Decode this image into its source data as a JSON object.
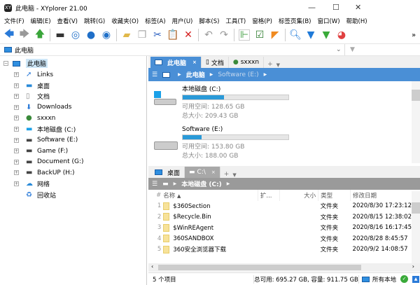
{
  "window": {
    "title": "此电脑 - XYplorer 21.00",
    "logo": "XY"
  },
  "menu": [
    "文件(F)",
    "编辑(E)",
    "查看(V)",
    "跳转(G)",
    "收藏夹(O)",
    "标签(A)",
    "用户(U)",
    "脚本(S)",
    "工具(T)",
    "窗格(P)",
    "标签页集(B)",
    "窗口(W)",
    "帮助(H)"
  ],
  "toolbar": {
    "icons": [
      "back-arrow-icon",
      "forward-arrow-icon",
      "up-arrow-icon",
      "computer-icon",
      "target-icon",
      "search-circle-icon",
      "goto-icon",
      "new-folder-icon",
      "copy-icon",
      "cut-icon",
      "paste-icon",
      "delete-icon",
      "undo-icon",
      "redo-icon",
      "tree-icon",
      "checkbox-icon",
      "pizza-icon",
      "search-icon",
      "filter-icon",
      "green-filter-icon",
      "pie-chart-icon"
    ],
    "more": "»"
  },
  "address": {
    "value": "此电脑"
  },
  "tree": {
    "root": "此电脑",
    "items": [
      "Links",
      "桌面",
      "文档",
      "Downloads",
      "sxxxn",
      "本地磁盘 (C:)",
      "Software (E:)",
      "Game (F:)",
      "Document (G:)",
      "BackUP (H:)",
      "网络",
      "回收站"
    ]
  },
  "pane1": {
    "tabs": [
      "此电脑",
      "文档",
      "sxxxn"
    ],
    "crumbs": [
      "此电脑",
      "Software (E:)"
    ],
    "drives": [
      {
        "name": "本地磁盘 (C:)",
        "used_fraction": 0.39,
        "free": "可用空间: 128.65 GB",
        "total": "总大小: 209.43 GB"
      },
      {
        "name": "Software (E:)",
        "used_fraction": 0.18,
        "free": "可用空间: 153.80 GB",
        "total": "总大小: 188.00 GB"
      }
    ]
  },
  "pane2": {
    "tabs": [
      "桌面",
      "C:\\"
    ],
    "crumbs": [
      "本地磁盘 (C:)"
    ],
    "columns": [
      "#",
      "名称",
      "扩...",
      "大小",
      "类型",
      "修改日期"
    ],
    "rows": [
      [
        "1",
        "$360Section",
        "",
        "",
        "文件夹",
        "2020/8/30 17:23:12"
      ],
      [
        "2",
        "$Recycle.Bin",
        "",
        "",
        "文件夹",
        "2020/8/15 12:38:02"
      ],
      [
        "3",
        "$WinREAgent",
        "",
        "",
        "文件夹",
        "2020/8/16 16:17:45"
      ],
      [
        "4",
        "360SANDBOX",
        "",
        "",
        "文件夹",
        "2020/8/28 8:45:57"
      ],
      [
        "5",
        "360安全浏览器下载",
        "",
        "",
        "文件夹",
        "2020/9/2 14:08:57"
      ]
    ]
  },
  "status": {
    "count": "5 个项目",
    "space": "总可用: 695.27 GB, 容量: 911.75 GB",
    "location": "所有本地"
  },
  "colors": {
    "accent": "#4a8fd6",
    "inactive_crumb": "#9a9a9a",
    "progress": "#2a9ad8"
  }
}
